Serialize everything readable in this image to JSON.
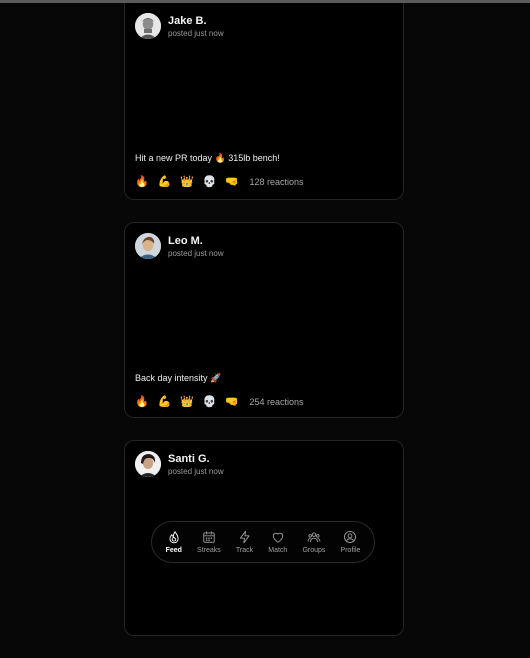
{
  "feed": {
    "posts": [
      {
        "author": "Jake B.",
        "meta": "posted just now",
        "caption": "Hit a new PR today 🔥 315lb bench!",
        "reactions": [
          "🔥",
          "💪",
          "👑",
          "💀",
          "🤜"
        ],
        "reaction_count": "128 reactions"
      },
      {
        "author": "Leo M.",
        "meta": "posted just now",
        "caption": "Back day intensity 🚀",
        "reactions": [
          "🔥",
          "💪",
          "👑",
          "💀",
          "🤜"
        ],
        "reaction_count": "254 reactions"
      },
      {
        "author": "Santi G.",
        "meta": "posted just now"
      }
    ]
  },
  "nav": {
    "items": [
      {
        "label": "Feed",
        "icon": "flame-icon",
        "active": true
      },
      {
        "label": "Streaks",
        "icon": "calendar-icon"
      },
      {
        "label": "Track",
        "icon": "lightning-icon"
      },
      {
        "label": "Match",
        "icon": "heart-icon"
      },
      {
        "label": "Groups",
        "icon": "groups-icon"
      },
      {
        "label": "Profile",
        "icon": "profile-icon"
      }
    ]
  }
}
